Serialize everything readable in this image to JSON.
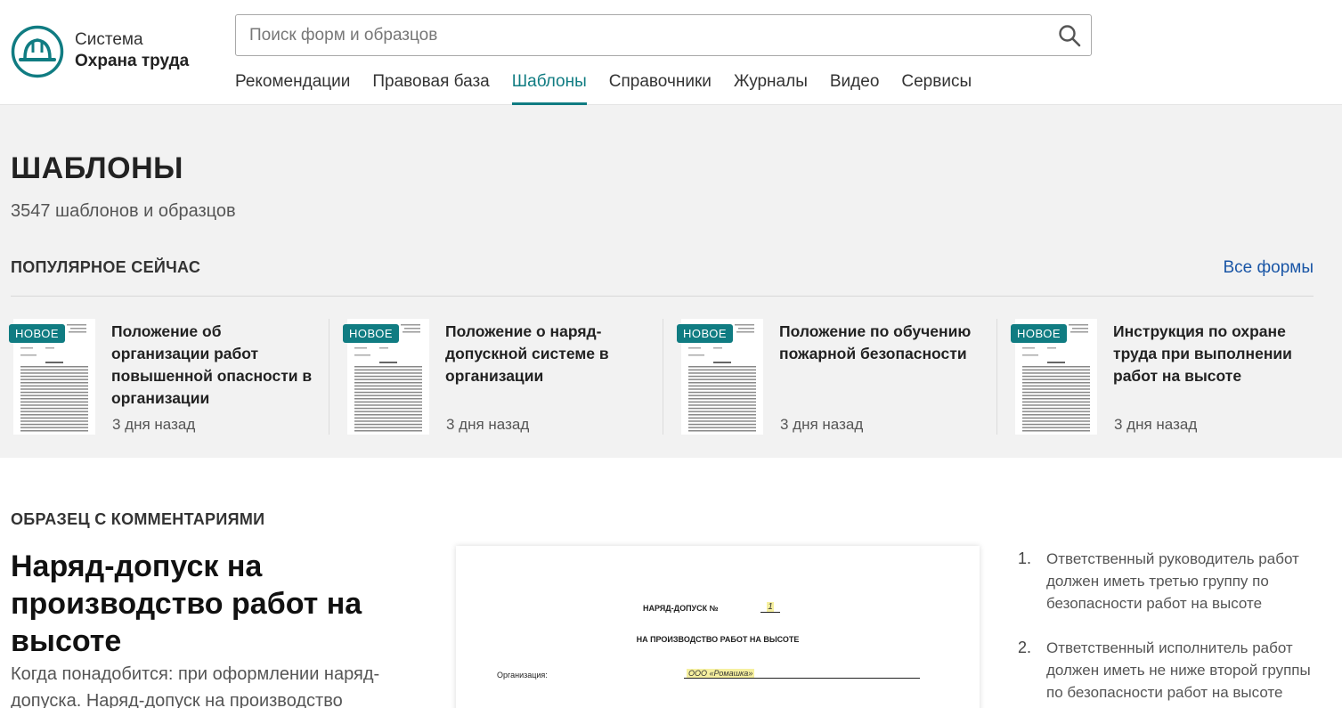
{
  "header": {
    "logo_line1": "Система",
    "logo_line2": "Охрана труда",
    "search_placeholder": "Поиск форм и образцов",
    "nav": [
      {
        "label": "Рекомендации"
      },
      {
        "label": "Правовая база"
      },
      {
        "label": "Шаблоны",
        "active": true
      },
      {
        "label": "Справочники"
      },
      {
        "label": "Журналы"
      },
      {
        "label": "Видео"
      },
      {
        "label": "Сервисы"
      }
    ]
  },
  "page": {
    "title": "ШАБЛОНЫ",
    "count": "3547 шаблонов и образцов"
  },
  "popular": {
    "title": "ПОПУЛЯРНОЕ СЕЙЧАС",
    "all_link": "Все формы",
    "cards": [
      {
        "badge": "НОВОЕ",
        "title": "Положение об организации работ повышенной опасности в организации",
        "date": "3 дня назад"
      },
      {
        "badge": "НОВОЕ",
        "title": "Положение о наряд-допускной системе в организации",
        "date": "3 дня назад"
      },
      {
        "badge": "НОВОЕ",
        "title": "Положение по обучению пожарной безопасности",
        "date": "3 дня назад"
      },
      {
        "badge": "НОВОЕ",
        "title": "Инструкция по охране труда при выполнении работ на высоте",
        "date": "3 дня назад"
      }
    ]
  },
  "sample": {
    "heading": "ОБРАЗЕЦ С КОММЕНТАРИЯМИ",
    "title": "Наряд-допуск на производство работ на высоте",
    "description": "Когда понадобится: при оформлении наряд-допуска. Наряд-допуск на производство",
    "document": {
      "line1": "НАРЯД-ДОПУСК №",
      "number": "1",
      "line2": "НА ПРОИЗВОДСТВО РАБОТ НА ВЫСОТЕ",
      "org_label": "Организация:",
      "org_value": "ООО «Ромашка»"
    },
    "notes": [
      {
        "num": "1.",
        "text": "Ответственный руководитель работ должен иметь третью группу по безопасности работ на высоте"
      },
      {
        "num": "2.",
        "text": "Ответственный исполнитель работ должен иметь не ниже второй группы по безопасности работ на высоте"
      }
    ]
  },
  "colors": {
    "accent": "#107c82",
    "link": "#1a56a6",
    "band": "#f2f2f2"
  }
}
